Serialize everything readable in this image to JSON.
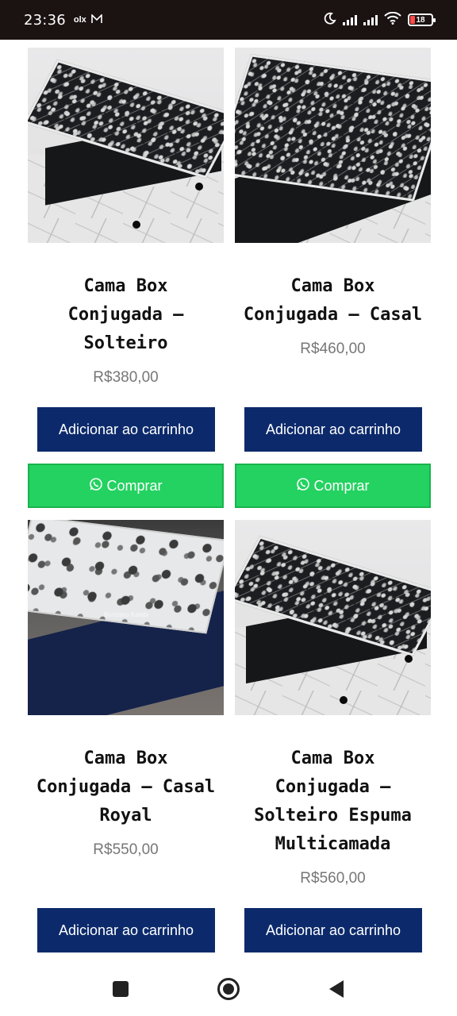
{
  "status_bar": {
    "time": "23:36",
    "app_icons": [
      "olx-icon",
      "mail-icon"
    ],
    "olx_label": "olx",
    "battery": "18"
  },
  "products": [
    {
      "title_lines": [
        "Cama Box",
        "Conjugada –",
        "Solteiro"
      ],
      "price": "R$380,00",
      "cart_label": "Adicionar ao carrinho",
      "buy_label": "Comprar"
    },
    {
      "title_lines": [
        "Cama Box",
        "Conjugada – Casal"
      ],
      "price": "R$460,00",
      "cart_label": "Adicionar ao carrinho",
      "buy_label": "Comprar"
    },
    {
      "title_lines": [
        "Cama Box",
        "Conjugada – Casal",
        "Royal"
      ],
      "price": "R$550,00",
      "cart_label": "Adicionar ao carrinho"
    },
    {
      "title_lines": [
        "Cama Box",
        "Conjugada –",
        "Solteiro Espuma",
        "Multicamada"
      ],
      "price": "R$560,00",
      "cart_label": "Adicionar ao carrinho"
    }
  ],
  "colors": {
    "cart_button": "#0c2a6b",
    "whatsapp_button": "#23d260",
    "price_text": "#777777"
  },
  "nav_bar": {
    "icons": [
      "recents-square-icon",
      "home-circle-icon",
      "back-triangle-icon"
    ]
  }
}
